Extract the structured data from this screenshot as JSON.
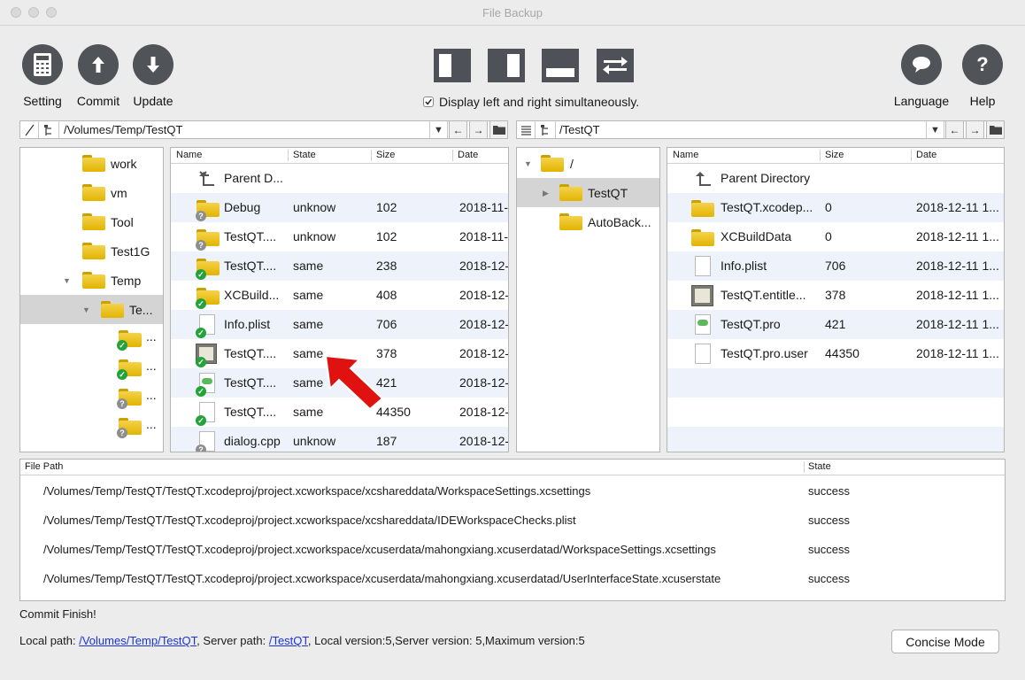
{
  "window": {
    "title": "File Backup"
  },
  "toolbar": {
    "setting": "Setting",
    "commit": "Commit",
    "update": "Update",
    "language": "Language",
    "help": "Help",
    "display_both": "Display left and right simultaneously.",
    "display_both_checked": true,
    "icon_color": "#505358"
  },
  "left_path": {
    "value": "/Volumes/Temp/TestQT"
  },
  "right_path": {
    "value": "/TestQT"
  },
  "left_tree": {
    "items": [
      {
        "label": "work"
      },
      {
        "label": "vm"
      },
      {
        "label": "Tool"
      },
      {
        "label": "Test1G"
      },
      {
        "label": "Temp"
      },
      {
        "label": "Te..."
      },
      {
        "label": "..."
      },
      {
        "label": "..."
      },
      {
        "label": "..."
      },
      {
        "label": "..."
      }
    ]
  },
  "left_files": {
    "columns": {
      "name": "Name",
      "state": "State",
      "size": "Size",
      "date": "Date"
    },
    "rows": [
      {
        "name": "Parent D...",
        "state": "",
        "size": "",
        "date": ""
      },
      {
        "name": "Debug",
        "state": "unknow",
        "size": "102",
        "date": "2018-11-"
      },
      {
        "name": "TestQT....",
        "state": "unknow",
        "size": "102",
        "date": "2018-11-"
      },
      {
        "name": "TestQT....",
        "state": "same",
        "size": "238",
        "date": "2018-12-"
      },
      {
        "name": "XCBuild...",
        "state": "same",
        "size": "408",
        "date": "2018-12-"
      },
      {
        "name": "Info.plist",
        "state": "same",
        "size": "706",
        "date": "2018-12-"
      },
      {
        "name": "TestQT....",
        "state": "same",
        "size": "378",
        "date": "2018-12-"
      },
      {
        "name": "TestQT....",
        "state": "same",
        "size": "421",
        "date": "2018-12-"
      },
      {
        "name": "TestQT....",
        "state": "same",
        "size": "44350",
        "date": "2018-12-"
      },
      {
        "name": "dialog.cpp",
        "state": "unknow",
        "size": "187",
        "date": "2018-12-"
      }
    ]
  },
  "right_tree": {
    "items": [
      {
        "label": "/"
      },
      {
        "label": "TestQT"
      },
      {
        "label": "AutoBack..."
      }
    ]
  },
  "right_files": {
    "columns": {
      "name": "Name",
      "size": "Size",
      "date": "Date"
    },
    "rows": [
      {
        "name": "Parent Directory",
        "size": "",
        "date": ""
      },
      {
        "name": "TestQT.xcodep...",
        "size": "0",
        "date": "2018-12-11 1..."
      },
      {
        "name": "XCBuildData",
        "size": "0",
        "date": "2018-12-11 1..."
      },
      {
        "name": "Info.plist",
        "size": "706",
        "date": "2018-12-11 1..."
      },
      {
        "name": "TestQT.entitle...",
        "size": "378",
        "date": "2018-12-11 1..."
      },
      {
        "name": "TestQT.pro",
        "size": "421",
        "date": "2018-12-11 1..."
      },
      {
        "name": "TestQT.pro.user",
        "size": "44350",
        "date": "2018-12-11 1..."
      }
    ]
  },
  "log": {
    "columns": {
      "path": "File Path",
      "state": "State"
    },
    "rows": [
      {
        "path": "/Volumes/Temp/TestQT/TestQT.xcodeproj/project.xcworkspace/xcshareddata/WorkspaceSettings.xcsettings",
        "state": "success"
      },
      {
        "path": "/Volumes/Temp/TestQT/TestQT.xcodeproj/project.xcworkspace/xcshareddata/IDEWorkspaceChecks.plist",
        "state": "success"
      },
      {
        "path": "/Volumes/Temp/TestQT/TestQT.xcodeproj/project.xcworkspace/xcuserdata/mahongxiang.xcuserdatad/WorkspaceSettings.xcsettings",
        "state": "success"
      },
      {
        "path": "/Volumes/Temp/TestQT/TestQT.xcodeproj/project.xcworkspace/xcuserdata/mahongxiang.xcuserdatad/UserInterfaceState.xcuserstate",
        "state": "success"
      }
    ]
  },
  "status": {
    "message": "Commit Finish!",
    "local_label": "Local path: ",
    "local_path": "/Volumes/Temp/TestQT",
    "server_label": ", Server path: ",
    "server_path": "/TestQT",
    "versions": ", Local version:5,Server version: 5,Maximum version:5",
    "concise_mode": "Concise Mode"
  },
  "colors": {
    "accent_link": "#1a33d9",
    "row_alt": "#eef3fb",
    "selected": "#d4d4d4",
    "ok_badge": "#24a33b",
    "annotation_arrow": "#e0120f"
  }
}
